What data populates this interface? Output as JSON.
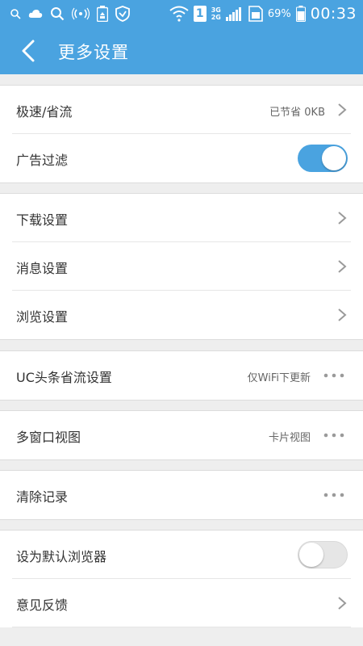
{
  "status_bar": {
    "battery_percent": "69%",
    "time": "00:33",
    "network_top": "3G",
    "network_bottom": "2G",
    "sim_slot": "1"
  },
  "header": {
    "title": "更多设置"
  },
  "settings": {
    "speed_saving": {
      "label": "极速/省流",
      "value": "已节省 0KB"
    },
    "ad_filter": {
      "label": "广告过滤",
      "enabled": true
    },
    "download": {
      "label": "下载设置"
    },
    "message": {
      "label": "消息设置"
    },
    "browse": {
      "label": "浏览设置"
    },
    "uc_headline": {
      "label": "UC头条省流设置",
      "value": "仅WiFi下更新"
    },
    "multi_window": {
      "label": "多窗口视图",
      "value": "卡片视图"
    },
    "clear_history": {
      "label": "清除记录"
    },
    "default_browser": {
      "label": "设为默认浏览器",
      "enabled": false
    },
    "feedback": {
      "label": "意见反馈"
    }
  },
  "colors": {
    "accent": "#4aa3e0",
    "background": "#eeeeee"
  }
}
